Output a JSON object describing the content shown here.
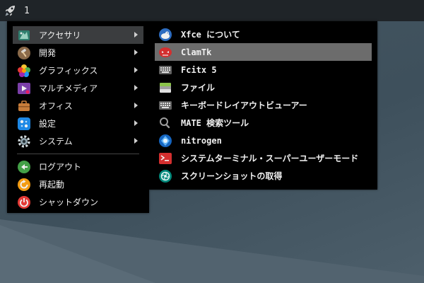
{
  "panel": {
    "launcher_icon": "rocket-icon",
    "workspace_number": "1"
  },
  "main_menu": {
    "categories": [
      {
        "label": "アクセサリ",
        "icon": "accessories-icon"
      },
      {
        "label": "開発",
        "icon": "hammer-icon"
      },
      {
        "label": "グラフィックス",
        "icon": "graphics-icon"
      },
      {
        "label": "マルチメディア",
        "icon": "multimedia-icon"
      },
      {
        "label": "オフィス",
        "icon": "briefcase-icon"
      },
      {
        "label": "設定",
        "icon": "settings-icon"
      },
      {
        "label": "システム",
        "icon": "gear-icon"
      }
    ],
    "actions": [
      {
        "label": "ログアウト",
        "icon": "logout-icon"
      },
      {
        "label": "再起動",
        "icon": "restart-icon"
      },
      {
        "label": "シャットダウン",
        "icon": "power-icon"
      }
    ]
  },
  "submenu": {
    "items": [
      {
        "label": "Xfce について",
        "icon": "xfce-mouse-icon"
      },
      {
        "label": "ClamTk",
        "icon": "clamtk-icon"
      },
      {
        "label": "Fcitx 5",
        "icon": "keyboard-icon"
      },
      {
        "label": "ファイル",
        "icon": "file-manager-icon"
      },
      {
        "label": "キーボードレイアウトビューアー",
        "icon": "keyboard-icon"
      },
      {
        "label": "MATE 検索ツール",
        "icon": "magnifier-icon"
      },
      {
        "label": "nitrogen",
        "icon": "nitrogen-icon"
      },
      {
        "label": "システムターミナル・スーパーユーザーモード",
        "icon": "terminal-icon"
      },
      {
        "label": "スクリーンショットの取得",
        "icon": "screenshot-icon"
      }
    ]
  },
  "colors": {
    "menu_bg": "#000000",
    "panel_bg": "#1f2428",
    "highlight": "#6c6c6c",
    "highlight_dim": "#3b3d3f",
    "desktop": "#3e505c"
  }
}
